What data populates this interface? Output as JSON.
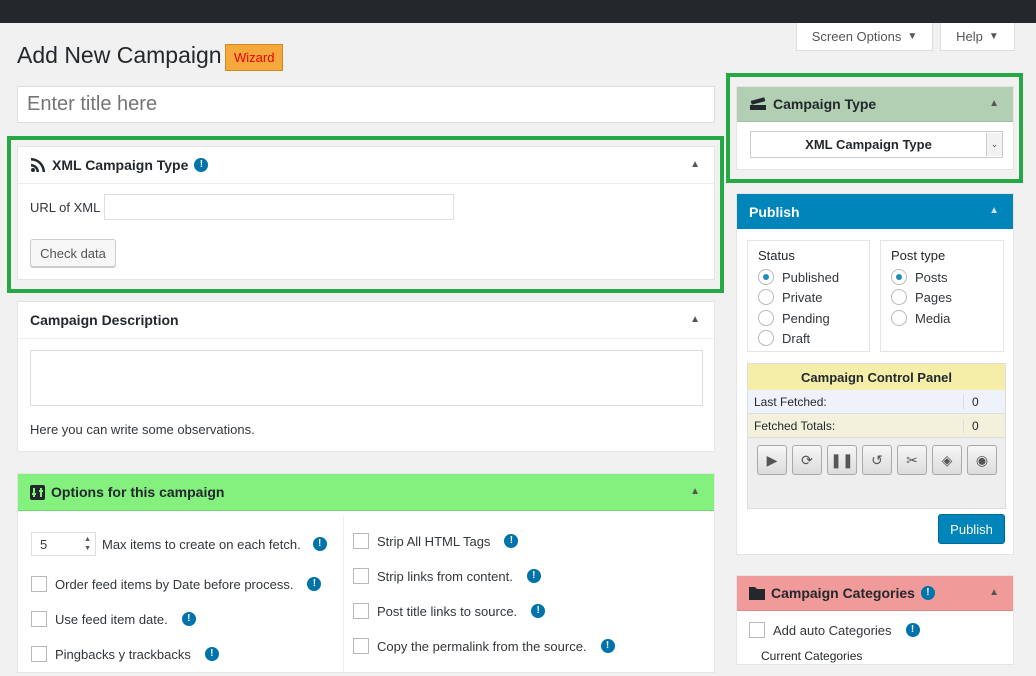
{
  "header": {
    "screen_options": "Screen Options",
    "help": "Help"
  },
  "page": {
    "title": "Add New Campaign",
    "wizard": "Wizard",
    "title_placeholder": "Enter title here"
  },
  "xml_box": {
    "title": "XML Campaign Type",
    "url_label": "URL of XML",
    "url_value": "",
    "check_button": "Check data"
  },
  "description_box": {
    "title": "Campaign Description",
    "value": "",
    "hint": "Here you can write some observations."
  },
  "options_box": {
    "title": "Options for this campaign",
    "max_items_value": "5",
    "max_items_label": "Max items to create on each fetch.",
    "left_items": [
      "Order feed items by Date before process.",
      "Use feed item date.",
      "Pingbacks y trackbacks"
    ],
    "right_items": [
      "Strip All HTML Tags",
      "Strip links from content.",
      "Post title links to source.",
      "Copy the permalink from the source."
    ]
  },
  "campaign_type_box": {
    "title": "Campaign Type",
    "selected": "XML Campaign Type"
  },
  "publish_box": {
    "title": "Publish",
    "status_label": "Status",
    "status_options": [
      "Published",
      "Private",
      "Pending",
      "Draft"
    ],
    "post_type_label": "Post type",
    "post_type_options": [
      "Posts",
      "Pages",
      "Media"
    ],
    "control_panel_title": "Campaign Control Panel",
    "last_fetched_label": "Last Fetched:",
    "last_fetched_value": "0",
    "fetched_totals_label": "Fetched Totals:",
    "fetched_totals_value": "0",
    "publish_button": "Publish"
  },
  "categories_box": {
    "title": "Campaign Categories",
    "add_auto": "Add auto Categories",
    "current": "Current Categories"
  },
  "colors": {
    "green_frame": "#26a844",
    "publish_header": "#0085ba",
    "options_header": "#84f07e",
    "categories_header": "#f19a9a",
    "type_header": "#b3cfb3"
  }
}
